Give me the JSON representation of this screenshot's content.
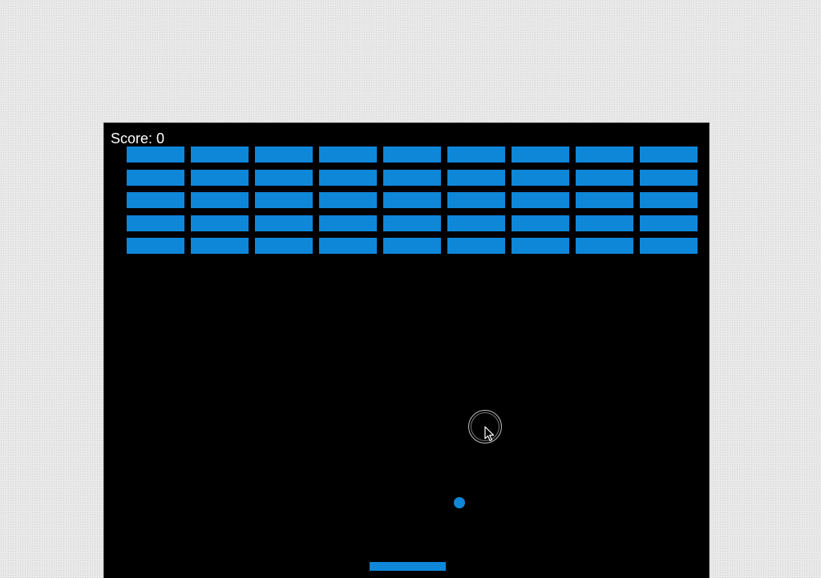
{
  "score": {
    "label": "Score: 0",
    "value": 0
  },
  "bricks": {
    "rows": 5,
    "columns": 9
  },
  "colors": {
    "canvas_background": "#000000",
    "brick": "#0f87d9",
    "ball": "#0f87d9",
    "paddle": "#0f87d9",
    "score_text": "#ffffff"
  },
  "icons": {
    "cursor": "cursor-arrow-icon"
  }
}
